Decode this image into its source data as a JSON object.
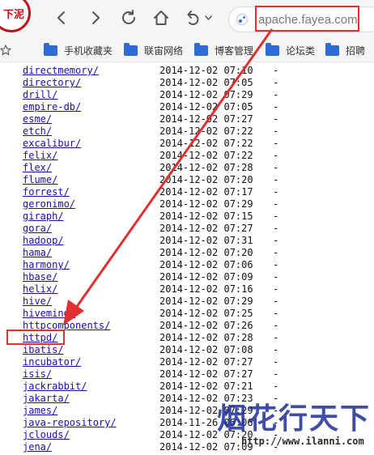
{
  "logo": {
    "text": "下泥"
  },
  "address_bar": {
    "url": "apache.fayea.com"
  },
  "bookmarks": [
    {
      "label": "手机收藏夹"
    },
    {
      "label": "联宙网络"
    },
    {
      "label": "博客管理"
    },
    {
      "label": "论坛类"
    },
    {
      "label": "招聘"
    }
  ],
  "listing": [
    {
      "name": "directmemory/",
      "date": "2014-12-02 07:10",
      "size": "-"
    },
    {
      "name": "directory/",
      "date": "2014-12-02 07:05",
      "size": "-"
    },
    {
      "name": "drill/",
      "date": "2014-12-02 07:29",
      "size": "-"
    },
    {
      "name": "empire-db/",
      "date": "2014-12-02 07:05",
      "size": "-"
    },
    {
      "name": "esme/",
      "date": "2014-12-02 07:27",
      "size": "-"
    },
    {
      "name": "etch/",
      "date": "2014-12-02 07:22",
      "size": "-"
    },
    {
      "name": "excalibur/",
      "date": "2014-12-02 07:22",
      "size": "-"
    },
    {
      "name": "felix/",
      "date": "2014-12-02 07:22",
      "size": "-"
    },
    {
      "name": "flex/",
      "date": "2014-12-02 07:28",
      "size": "-"
    },
    {
      "name": "flume/",
      "date": "2014-12-02 07:20",
      "size": "-"
    },
    {
      "name": "forrest/",
      "date": "2014-12-02 07:17",
      "size": "-"
    },
    {
      "name": "geronimo/",
      "date": "2014-12-02 07:29",
      "size": "-"
    },
    {
      "name": "giraph/",
      "date": "2014-12-02 07:15",
      "size": "-"
    },
    {
      "name": "gora/",
      "date": "2014-12-02 07:27",
      "size": "-"
    },
    {
      "name": "hadoop/",
      "date": "2014-12-02 07:31",
      "size": "-"
    },
    {
      "name": "hama/",
      "date": "2014-12-02 07:20",
      "size": "-"
    },
    {
      "name": "harmony/",
      "date": "2014-12-02 07:06",
      "size": "-"
    },
    {
      "name": "hbase/",
      "date": "2014-12-02 07:09",
      "size": "-"
    },
    {
      "name": "helix/",
      "date": "2014-12-02 07:16",
      "size": "-"
    },
    {
      "name": "hive/",
      "date": "2014-12-02 07:29",
      "size": "-"
    },
    {
      "name": "hivemind/",
      "date": "2014-12-02 07:25",
      "size": "-"
    },
    {
      "name": "httpcomponents/",
      "date": "2014-12-02 07:26",
      "size": "-"
    },
    {
      "name": "httpd/",
      "date": "2014-12-02 07:28",
      "size": "-"
    },
    {
      "name": "ibatis/",
      "date": "2014-12-02 07:08",
      "size": "-"
    },
    {
      "name": "incubator/",
      "date": "2014-12-02 07:27",
      "size": "-"
    },
    {
      "name": "isis/",
      "date": "2014-12-02 07:27",
      "size": "-"
    },
    {
      "name": "jackrabbit/",
      "date": "2014-12-02 07:21",
      "size": "-"
    },
    {
      "name": "jakarta/",
      "date": "2014-12-02 07:23",
      "size": "-"
    },
    {
      "name": "james/",
      "date": "2014-12-02 07:29",
      "size": "-"
    },
    {
      "name": "java-repository/",
      "date": "2014-11-26 06:06",
      "size": "-"
    },
    {
      "name": "jclouds/",
      "date": "2014-12-02 07:20",
      "size": "-"
    },
    {
      "name": "jena/",
      "date": "2014-12-02 07:09",
      "size": "-"
    }
  ],
  "watermark": {
    "script": "烟花行天下",
    "url": "http://www.ilanni.com"
  },
  "colors": {
    "annotation": "#e03030",
    "link": "#1a0dab",
    "folder": "#2f6bd0"
  }
}
